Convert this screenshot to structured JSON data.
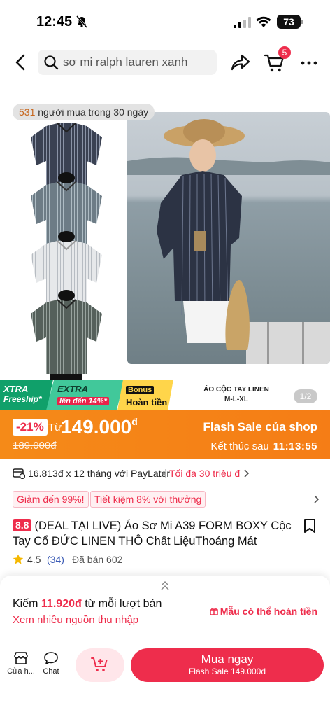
{
  "status_bar": {
    "time": "12:45",
    "battery": "73"
  },
  "search": {
    "query": "sơ mi ralph lauren xanh"
  },
  "cart": {
    "badge": "5"
  },
  "gallery": {
    "buyers_count": "531",
    "buyers_text": "người mua trong 30 ngày",
    "promo_xtra": "XTRA",
    "promo_freeship": "Freeship*",
    "promo_extra": "EXTRA",
    "promo_extra_value": "lên đến 14%*",
    "promo_bonus": "Bonus",
    "promo_refund": "Hoàn tiền",
    "caption_line1": "ÁO CỘC TAY LINEN",
    "caption_line2": "M-L-XL",
    "counter": "1/2"
  },
  "flash_sale": {
    "discount": "-21%",
    "from_label": "Từ",
    "price": "149.000",
    "currency": "đ",
    "original_price": "189.000đ",
    "title": "Flash Sale của shop",
    "ends_label": "Kết thúc sau",
    "countdown": "11:13:55",
    "accent": "#f58a18"
  },
  "paylater": {
    "text": "16.813đ x 12 tháng với PayLater",
    "limit": "Tối đa 30 triệu đ"
  },
  "vouchers": [
    "Giảm đến 99%!",
    "Tiết kiệm 8% với thưởng"
  ],
  "product": {
    "score_badge": "8.8",
    "title": "(DEAL TẠI LIVE) Áo Sơ Mi A39 FORM BOXY Cộc Tay Cổ ĐỨC  LINEN THÔ Chất LiệuThoáng Mát",
    "rating": "4.5",
    "reviews": "(34)",
    "sold": "Đã bán 602"
  },
  "affiliate": {
    "earn_prefix": "Kiếm",
    "earn_amount": "11.920đ",
    "earn_suffix": "từ mỗi lượt bán",
    "income_link": "Xem nhiều nguồn thu nhập",
    "sample": "Mẫu có thể hoàn tiền"
  },
  "bottom_bar": {
    "shop_label": "Cửa h...",
    "chat_label": "Chat",
    "buy_label": "Mua ngay",
    "buy_sub": "Flash Sale 149.000đ",
    "brand_color": "#ee2d4c"
  }
}
